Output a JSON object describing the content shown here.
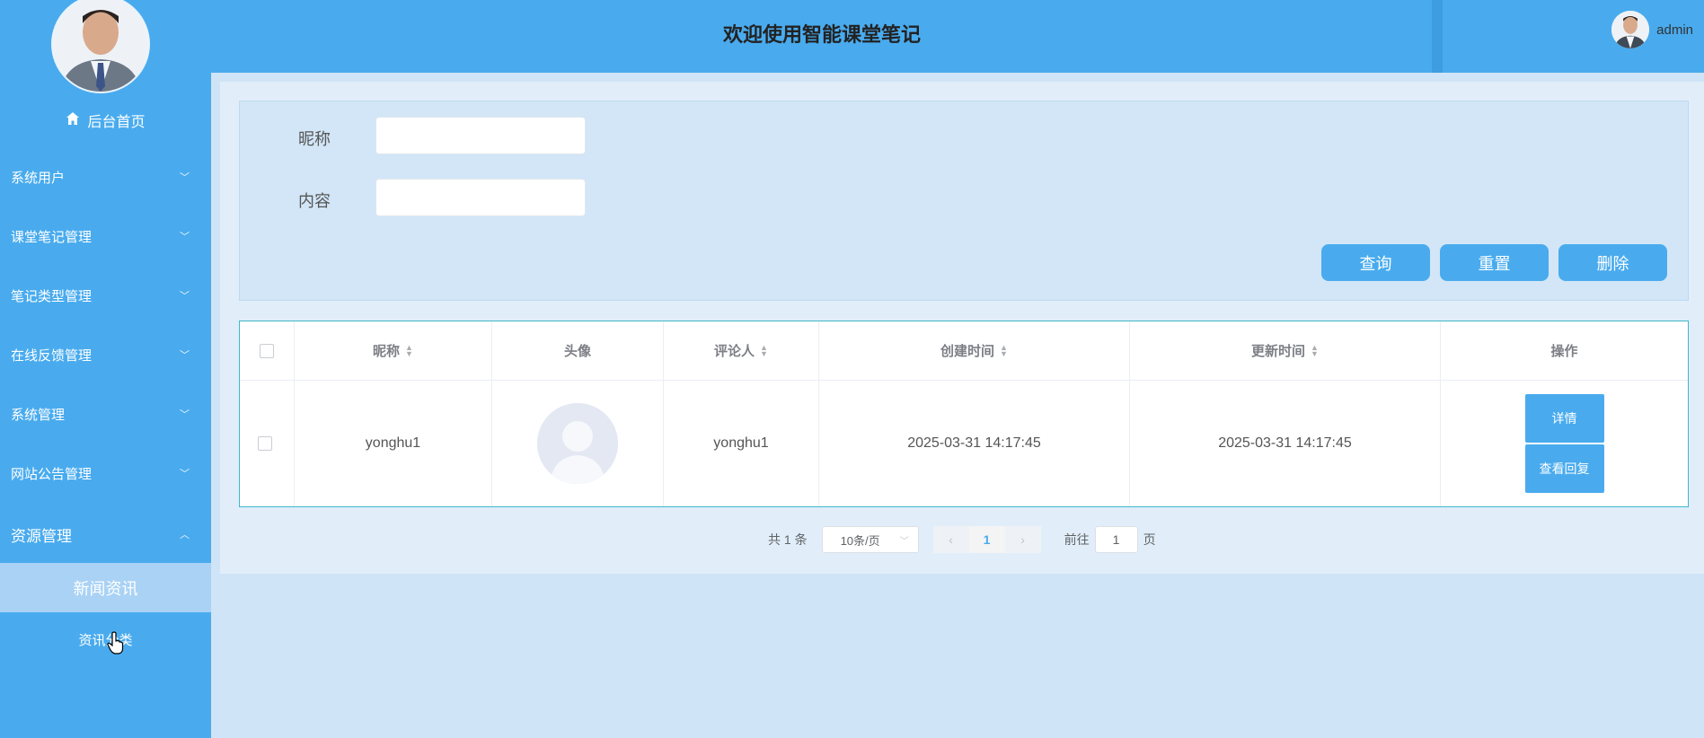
{
  "app": {
    "title": "欢迎使用智能课堂笔记",
    "username": "admin"
  },
  "sidebar": {
    "home_label": "后台首页",
    "items": [
      {
        "label": "系统用户",
        "expanded": false
      },
      {
        "label": "课堂笔记管理",
        "expanded": false
      },
      {
        "label": "笔记类型管理",
        "expanded": false
      },
      {
        "label": "在线反馈管理",
        "expanded": false
      },
      {
        "label": "系统管理",
        "expanded": false
      },
      {
        "label": "网站公告管理",
        "expanded": false
      },
      {
        "label": "资源管理",
        "expanded": true
      }
    ],
    "submenu": {
      "active_label": "新闻资讯",
      "other_label": "资讯分类"
    },
    "chevron_down": "﹀",
    "chevron_up": "︿"
  },
  "search": {
    "nickname_label": "昵称",
    "nickname_value": "",
    "content_label": "内容",
    "content_value": "",
    "query_button": "查询",
    "reset_button": "重置",
    "delete_button": "删除"
  },
  "table": {
    "columns": {
      "nickname": "昵称",
      "avatar": "头像",
      "commenter": "评论人",
      "created": "创建时间",
      "updated": "更新时间",
      "actions": "操作"
    },
    "rows": [
      {
        "nickname": "yonghu1",
        "commenter": "yonghu1",
        "created": "2025-03-31 14:17:45",
        "updated": "2025-03-31 14:17:45",
        "detail_button": "详情",
        "reply_button": "查看回复"
      }
    ]
  },
  "pagination": {
    "total_text": "共 1 条",
    "page_size": "10条/页",
    "current_page": "1",
    "goto_label": "前往",
    "goto_value": "1",
    "page_suffix": "页"
  },
  "colors": {
    "primary": "#49abee",
    "background": "#cfe4f6",
    "table_border": "#3fb8c9"
  }
}
